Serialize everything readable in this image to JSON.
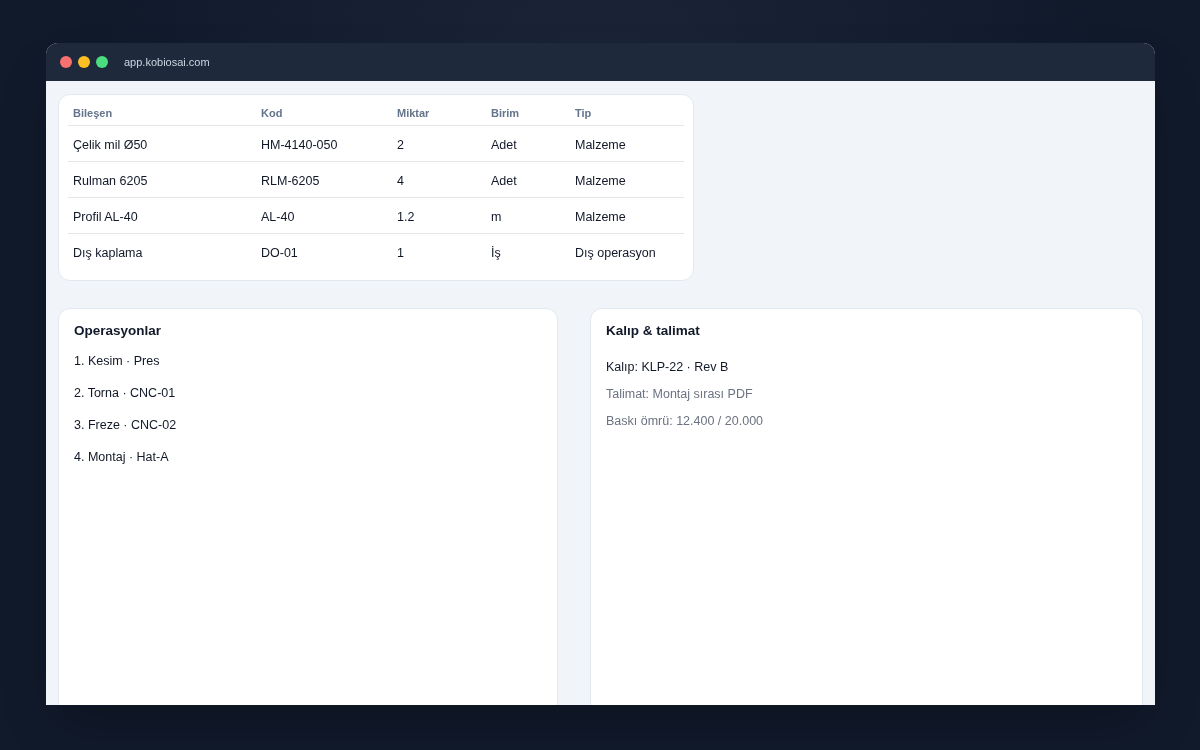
{
  "browser": {
    "url": "app.kobiosai.com"
  },
  "table": {
    "columns": [
      "Bileşen",
      "Kod",
      "Miktar",
      "Birim",
      "Tip"
    ],
    "rows": [
      [
        "Çelik mil Ø50",
        "HM-4140-050",
        "2",
        "Adet",
        "Malzeme"
      ],
      [
        "Rulman 6205",
        "RLM-6205",
        "4",
        "Adet",
        "Malzeme"
      ],
      [
        "Profil AL-40",
        "AL-40",
        "1.2",
        "m",
        "Malzeme"
      ],
      [
        "Dış kaplama",
        "DO-01",
        "1",
        "İş",
        "Dış operasyon"
      ]
    ]
  },
  "operations": {
    "title": "Operasyonlar",
    "items": [
      "1. Kesim · Pres",
      "2. Torna · CNC-01",
      "3. Freze · CNC-02",
      "4. Montaj · Hat-A"
    ]
  },
  "mold": {
    "title": "Kalıp & talimat",
    "lines": [
      {
        "kind": "primary",
        "text": "Kalıp: KLP-22 · Rev B"
      },
      {
        "kind": "muted",
        "text": "Talimat: Montaj sırası PDF"
      },
      {
        "kind": "muted",
        "text": "Baskı ömrü: 12.400 / 20.000"
      }
    ]
  }
}
